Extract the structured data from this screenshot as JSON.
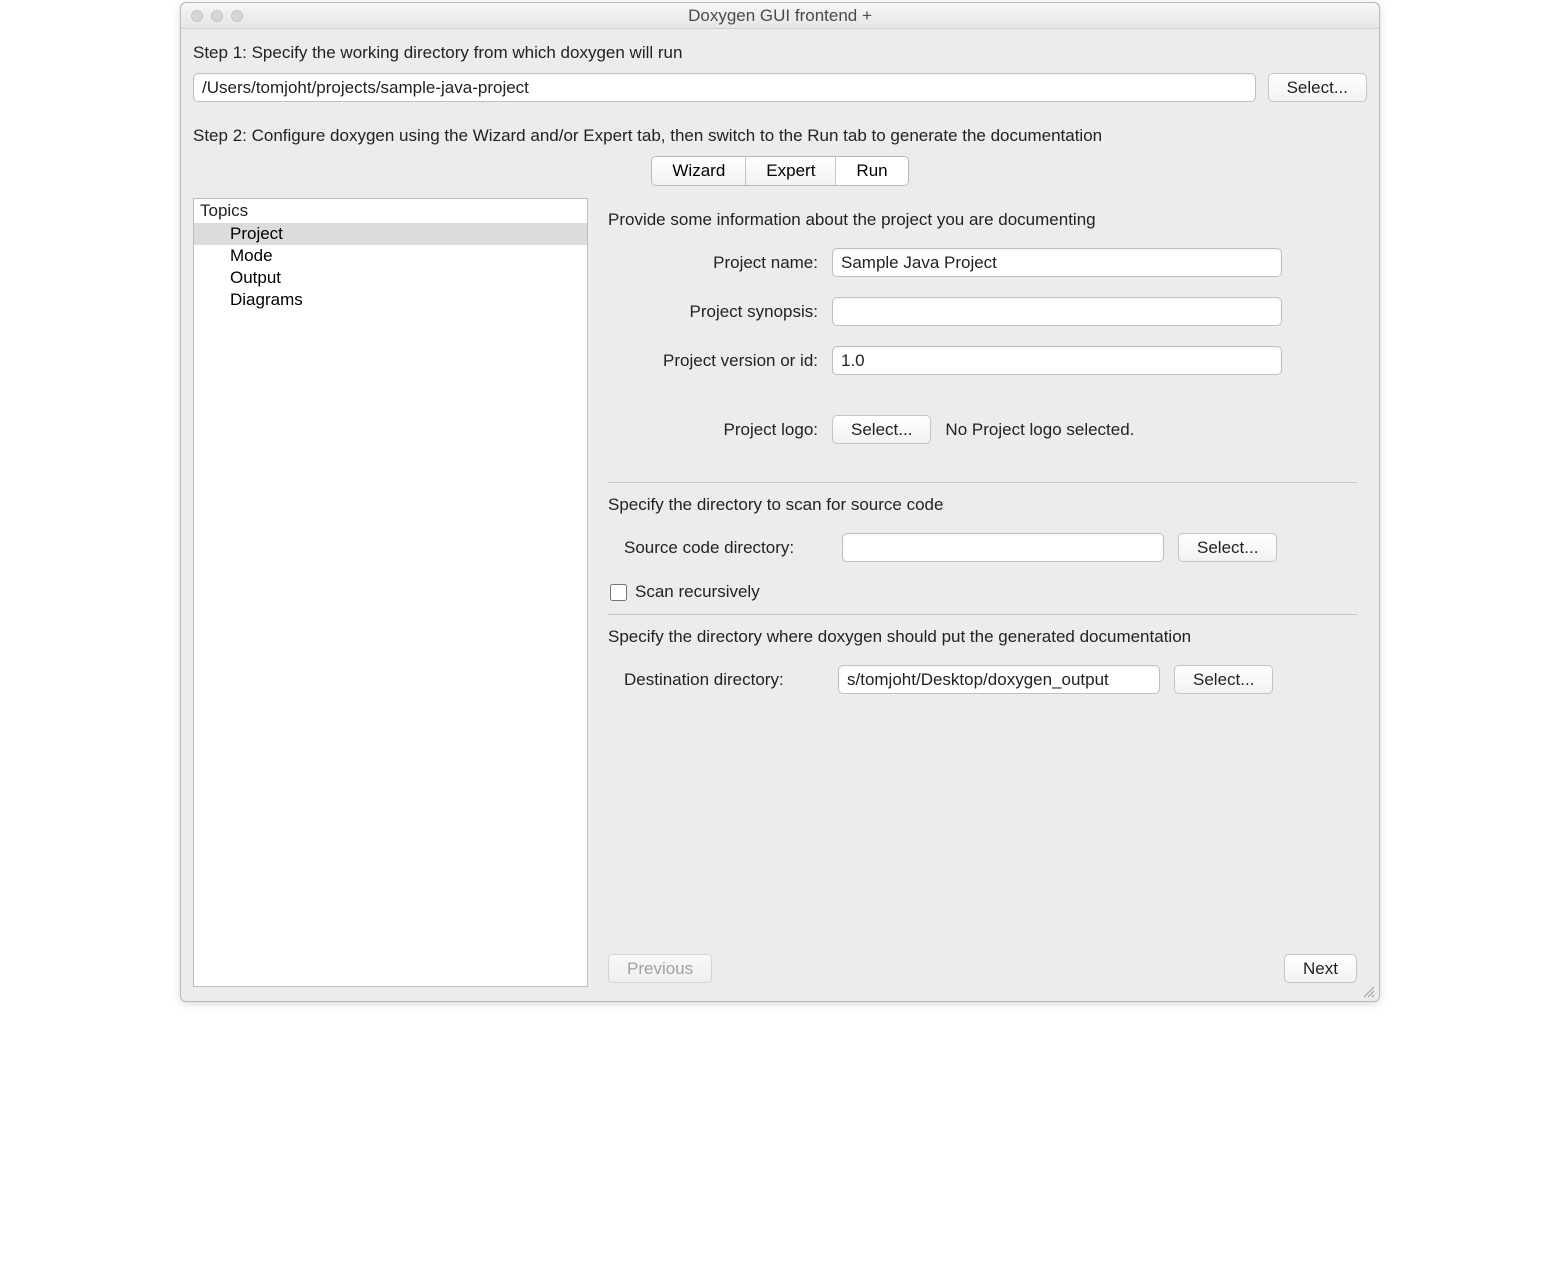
{
  "window": {
    "title": "Doxygen GUI frontend +"
  },
  "step1": {
    "label": "Step 1: Specify the working directory from which doxygen will run",
    "dir_value": "/Users/tomjoht/projects/sample-java-project",
    "select_btn": "Select..."
  },
  "step2": {
    "label": "Step 2: Configure doxygen using the Wizard and/or Expert tab, then switch to the Run tab to generate the documentation"
  },
  "tabs": {
    "wizard": "Wizard",
    "expert": "Expert",
    "run": "Run"
  },
  "topics": {
    "header": "Topics",
    "items": [
      "Project",
      "Mode",
      "Output",
      "Diagrams"
    ]
  },
  "project_section": {
    "intro": "Provide some information about the project you are documenting",
    "name_label": "Project name:",
    "name_value": "Sample Java Project",
    "synopsis_label": "Project synopsis:",
    "synopsis_value": "",
    "version_label": "Project version or id:",
    "version_value": "1.0",
    "logo_label": "Project logo:",
    "logo_select_btn": "Select...",
    "logo_status": "No Project logo selected."
  },
  "source_section": {
    "intro": "Specify the directory to scan for source code",
    "dir_label": "Source code directory:",
    "dir_value": "",
    "select_btn": "Select...",
    "recursive_label": "Scan recursively"
  },
  "dest_section": {
    "intro": "Specify the directory where doxygen should put the generated documentation",
    "dir_label": "Destination directory:",
    "dir_value": "s/tomjoht/Desktop/doxygen_output",
    "select_btn": "Select..."
  },
  "nav": {
    "previous": "Previous",
    "next": "Next"
  }
}
